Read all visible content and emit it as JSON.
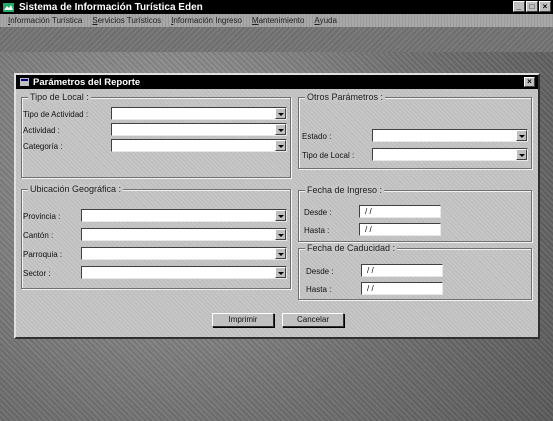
{
  "app": {
    "title": "Sistema de Información Turística  Eden",
    "window_controls": [
      "_",
      "□",
      "×"
    ]
  },
  "menu": [
    "Información Turística",
    "Servicios Turísticos",
    "Información Ingreso",
    "Mantenimiento",
    "Ayuda"
  ],
  "dialog": {
    "title": "Parámetros del Reporte",
    "close_glyph": "×",
    "tipo_local": {
      "legend": "Tipo de Local :",
      "fields": [
        {
          "label": "Tipo de Actividad :",
          "value": ""
        },
        {
          "label": "Actividad :",
          "value": ""
        },
        {
          "label": "Categoría :",
          "value": ""
        }
      ]
    },
    "ubicacion": {
      "legend": "Ubicación Geográfica :",
      "fields": [
        {
          "label": "Provincia :",
          "value": ""
        },
        {
          "label": "Cantón :",
          "value": ""
        },
        {
          "label": "Parroquia :",
          "value": ""
        },
        {
          "label": "Sector :",
          "value": ""
        }
      ]
    },
    "otros": {
      "legend": "Otros Parámetros :",
      "fields": [
        {
          "label": "Estado :",
          "value": ""
        },
        {
          "label": "Tipo de Local :",
          "value": ""
        }
      ]
    },
    "fecha_ingreso": {
      "legend": "Fecha de Ingreso :",
      "desde_label": "Desde :",
      "desde_value": "/ /",
      "hasta_label": "Hasta :",
      "hasta_value": "/ /"
    },
    "fecha_caducidad": {
      "legend": "Fecha de Caducidad :",
      "desde_label": "Desde :",
      "desde_value": "/ /",
      "hasta_label": "Hasta :",
      "hasta_value": "/ /"
    },
    "buttons": {
      "imprimir": "Imprimir",
      "cancelar": "Cancelar"
    }
  }
}
